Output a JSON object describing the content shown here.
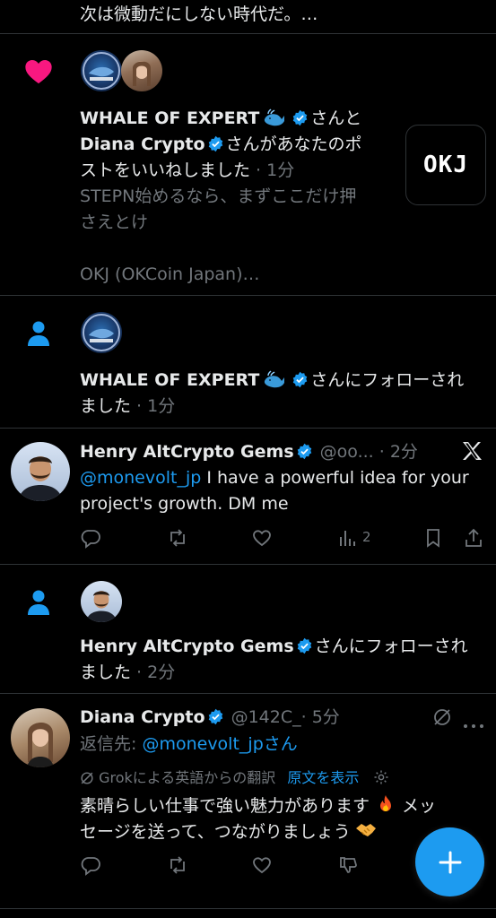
{
  "top_snippet": "次は微動だにしない時代だ。…",
  "like_notif": {
    "name1": "WHALE OF EXPERT",
    "joiner": "さんと",
    "name2": "Diana Crypto",
    "text_tail1": "さんがあなたのポ",
    "text_line2": "ストをいいねしました",
    "time": " · 1分",
    "quote_line1": "STEPN始めるなら、まずここだけ押",
    "quote_line2": "さえとけ",
    "quote_line3": "OKJ (OKCoin Japan)…",
    "thumb_logo": "OKJ"
  },
  "follow_notif1": {
    "name": "WHALE OF EXPERT",
    "tail": "さんにフォローされ",
    "line2": "ました",
    "time": " · 1分"
  },
  "reply_henry": {
    "name": "Henry AltCrypto Gems",
    "handle": "@oo...",
    "time": "· 2分",
    "mention": "@monevolt_jp",
    "body_rest": " I have a powerful idea for your",
    "body_line2": "project's growth. DM me",
    "views": "2"
  },
  "follow_notif2": {
    "name": "Henry AltCrypto Gems",
    "tail": "さんにフォローされ",
    "line2": "ました",
    "time": " · 2分"
  },
  "reply_diana": {
    "name": "Diana Crypto",
    "handle": "@142C_",
    "time": "· 5分",
    "reply_prefix": "返信先: ",
    "reply_to": "@monevolt_jpさん",
    "translate_note": "Grokによる英語からの翻訳",
    "show_original": "原文を表示",
    "body_line1": "素晴らしい仕事で強い魅力があります",
    "body_line1_end": " メッ",
    "body_line2": "セージを送って、つながりましょう"
  },
  "colors": {
    "accent": "#1d9bf0",
    "like": "#f91880",
    "background": "#000000",
    "muted": "#71767b"
  }
}
